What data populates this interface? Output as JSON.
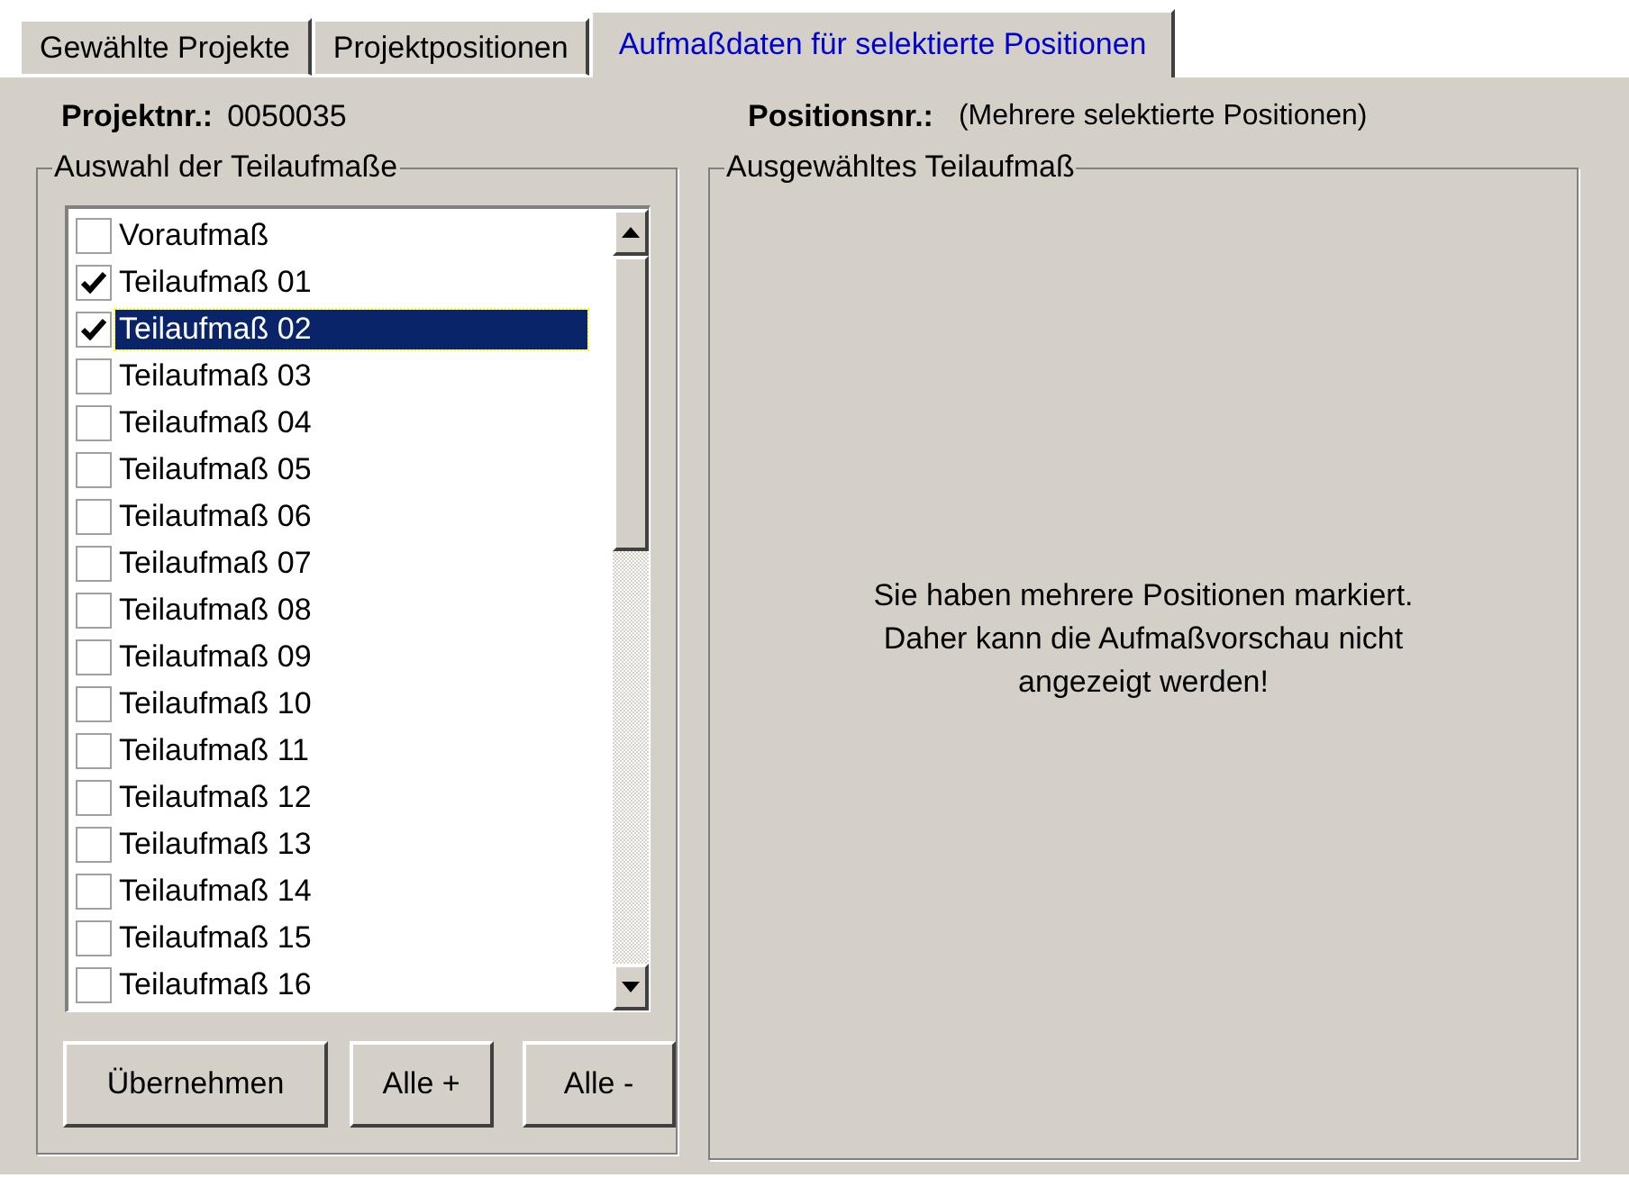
{
  "tabs": [
    {
      "label": "Gewählte Projekte",
      "selected": false
    },
    {
      "label": "Projektpositionen",
      "selected": false
    },
    {
      "label": "Aufmaßdaten für selektierte Positionen",
      "selected": true
    }
  ],
  "project": {
    "label": "Projektnr.:",
    "value": "0050035"
  },
  "position": {
    "label": "Positionsnr.:",
    "value": "(Mehrere selektierte Positionen)"
  },
  "selection_group": {
    "title": "Auswahl der Teilaufmaße",
    "items": [
      {
        "label": "Voraufmaß",
        "checked": false,
        "selected": false
      },
      {
        "label": "Teilaufmaß 01",
        "checked": true,
        "selected": false
      },
      {
        "label": "Teilaufmaß 02",
        "checked": true,
        "selected": true
      },
      {
        "label": "Teilaufmaß 03",
        "checked": false,
        "selected": false
      },
      {
        "label": "Teilaufmaß 04",
        "checked": false,
        "selected": false
      },
      {
        "label": "Teilaufmaß 05",
        "checked": false,
        "selected": false
      },
      {
        "label": "Teilaufmaß 06",
        "checked": false,
        "selected": false
      },
      {
        "label": "Teilaufmaß 07",
        "checked": false,
        "selected": false
      },
      {
        "label": "Teilaufmaß 08",
        "checked": false,
        "selected": false
      },
      {
        "label": "Teilaufmaß 09",
        "checked": false,
        "selected": false
      },
      {
        "label": "Teilaufmaß 10",
        "checked": false,
        "selected": false
      },
      {
        "label": "Teilaufmaß 11",
        "checked": false,
        "selected": false
      },
      {
        "label": "Teilaufmaß 12",
        "checked": false,
        "selected": false
      },
      {
        "label": "Teilaufmaß 13",
        "checked": false,
        "selected": false
      },
      {
        "label": "Teilaufmaß 14",
        "checked": false,
        "selected": false
      },
      {
        "label": "Teilaufmaß 15",
        "checked": false,
        "selected": false
      },
      {
        "label": "Teilaufmaß 16",
        "checked": false,
        "selected": false
      }
    ],
    "buttons": [
      "Übernehmen",
      "Alle +",
      "Alle -"
    ]
  },
  "preview_group": {
    "title": "Ausgewähltes Teilaufmaß",
    "message": "Sie haben mehrere Positionen markiert. Daher kann die Aufmaßvorschau nicht angezeigt werden!"
  }
}
